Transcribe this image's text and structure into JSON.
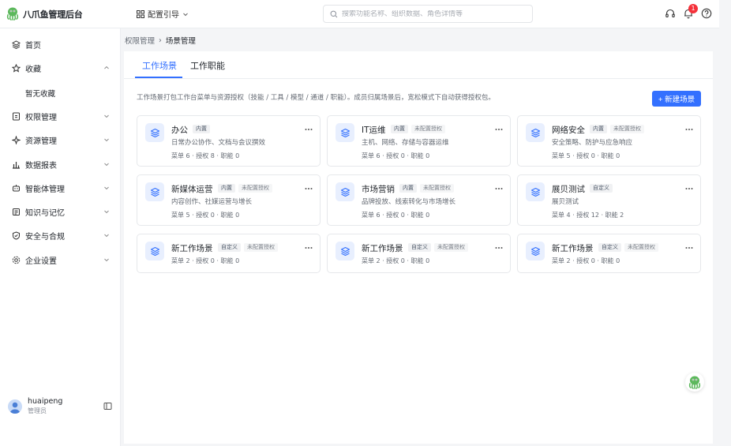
{
  "header": {
    "app_title": "八爪鱼管理后台",
    "config_guide": "配置引导",
    "search_placeholder": "搜索功能名称、组织数据、角色详情等",
    "notification_count": "1"
  },
  "sidebar": {
    "items": [
      {
        "label": "首页",
        "icon": "home-icon"
      },
      {
        "label": "收藏",
        "icon": "star-icon"
      },
      {
        "label": "权限管理",
        "icon": "permission-icon"
      },
      {
        "label": "资源管理",
        "icon": "resource-icon"
      },
      {
        "label": "数据报表",
        "icon": "chart-icon"
      },
      {
        "label": "智能体管理",
        "icon": "robot-icon"
      },
      {
        "label": "知识与记忆",
        "icon": "knowledge-icon"
      },
      {
        "label": "安全与合规",
        "icon": "shield-icon"
      },
      {
        "label": "企业设置",
        "icon": "gear-icon"
      }
    ],
    "favorites_empty": "暂无收藏",
    "user": {
      "name": "huaipeng",
      "role": "管理员"
    }
  },
  "breadcrumb": {
    "parent": "权限管理",
    "current": "场景管理"
  },
  "tabs": [
    {
      "label": "工作场景",
      "active": true
    },
    {
      "label": "工作职能",
      "active": false
    }
  ],
  "description": "工作场景打包工作台菜单与资源授权（技能 / 工具 / 模型 / 通道 / 职能）。成员归属场景后，宽松模式下自动获得授权包。",
  "new_button": "+ 新建场景",
  "cards": [
    {
      "name": "办公",
      "tags": [
        "内置"
      ],
      "desc": "日常办公协作、文档与会议撰效",
      "meta": "菜单 6 · 授权 8 · 职能 0"
    },
    {
      "name": "IT运维",
      "tags": [
        "内置",
        "未配置授权"
      ],
      "desc": "主机、网络、存储与容器运维",
      "meta": "菜单 6 · 授权 0 · 职能 0"
    },
    {
      "name": "网络安全",
      "tags": [
        "内置",
        "未配置授权"
      ],
      "desc": "安全策略、防护与应急响应",
      "meta": "菜单 5 · 授权 0 · 职能 0"
    },
    {
      "name": "新媒体运营",
      "tags": [
        "内置",
        "未配置授权"
      ],
      "desc": "内容创作、社媒运营与增长",
      "meta": "菜单 5 · 授权 0 · 职能 0"
    },
    {
      "name": "市场营销",
      "tags": [
        "内置",
        "未配置授权"
      ],
      "desc": "品牌投放、线索转化与市场增长",
      "meta": "菜单 6 · 授权 0 · 职能 0"
    },
    {
      "name": "展贝测试",
      "tags": [
        "自定义"
      ],
      "desc": "展贝测试",
      "meta": "菜单 4 · 授权 12 · 职能 2"
    },
    {
      "name": "新工作场景",
      "tags": [
        "自定义",
        "未配置授权"
      ],
      "desc": "",
      "meta": "菜单 2 · 授权 0 · 职能 0"
    },
    {
      "name": "新工作场景",
      "tags": [
        "自定义",
        "未配置授权"
      ],
      "desc": "",
      "meta": "菜单 2 · 授权 0 · 职能 0"
    },
    {
      "name": "新工作场景",
      "tags": [
        "自定义",
        "未配置授权"
      ],
      "desc": "",
      "meta": "菜单 2 · 授权 0 · 职能 0"
    }
  ],
  "colors": {
    "accent": "#3370ff",
    "badge": "#f5313a",
    "logo": "#4caf50"
  }
}
